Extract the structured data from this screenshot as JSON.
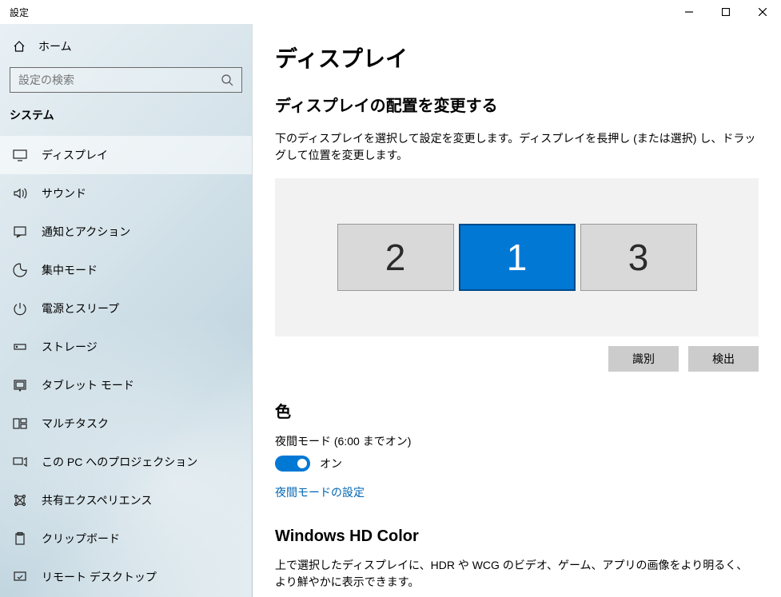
{
  "window": {
    "title": "設定"
  },
  "sidebar": {
    "home": "ホーム",
    "search_placeholder": "設定の検索",
    "category": "システム",
    "items": [
      {
        "label": "ディスプレイ",
        "icon": "display-icon",
        "selected": true
      },
      {
        "label": "サウンド",
        "icon": "sound-icon"
      },
      {
        "label": "通知とアクション",
        "icon": "notification-icon"
      },
      {
        "label": "集中モード",
        "icon": "focus-icon"
      },
      {
        "label": "電源とスリープ",
        "icon": "power-icon"
      },
      {
        "label": "ストレージ",
        "icon": "storage-icon"
      },
      {
        "label": "タブレット モード",
        "icon": "tablet-icon"
      },
      {
        "label": "マルチタスク",
        "icon": "multitask-icon"
      },
      {
        "label": "この PC へのプロジェクション",
        "icon": "projection-icon"
      },
      {
        "label": "共有エクスペリエンス",
        "icon": "shared-icon"
      },
      {
        "label": "クリップボード",
        "icon": "clipboard-icon"
      },
      {
        "label": "リモート デスクトップ",
        "icon": "remote-icon"
      }
    ]
  },
  "main": {
    "title": "ディスプレイ",
    "arrange_heading": "ディスプレイの配置を変更する",
    "arrange_desc": "下のディスプレイを選択して設定を変更します。ディスプレイを長押し (または選択) し、ドラッグして位置を変更します。",
    "monitors": [
      {
        "num": "2",
        "selected": false
      },
      {
        "num": "1",
        "selected": true
      },
      {
        "num": "3",
        "selected": false
      }
    ],
    "identify_btn": "識別",
    "detect_btn": "検出",
    "color_heading": "色",
    "night_label": "夜間モード (6:00 までオン)",
    "night_state": "オン",
    "night_settings_link": "夜間モードの設定",
    "hdcolor_heading": "Windows HD Color",
    "hdcolor_desc": "上で選択したディスプレイに、HDR や WCG のビデオ、ゲーム、アプリの画像をより明るく、より鮮やかに表示できます。"
  }
}
